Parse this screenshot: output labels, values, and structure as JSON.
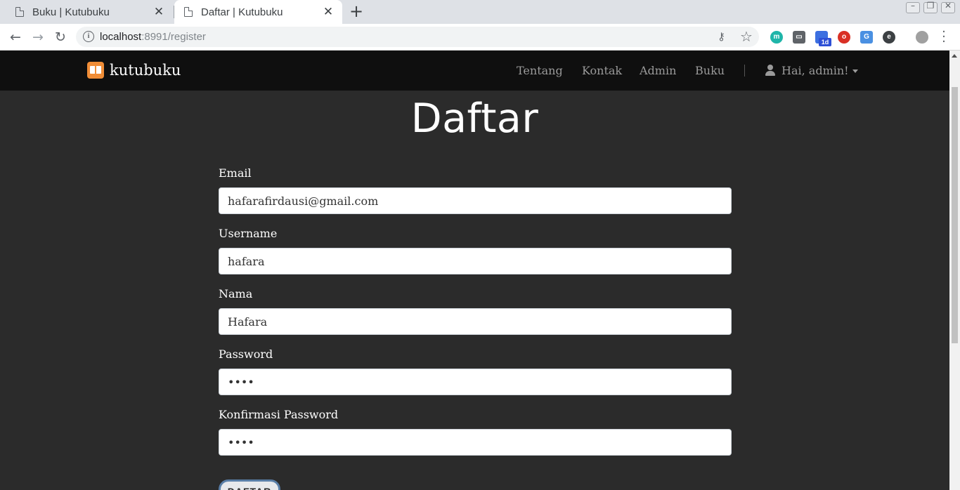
{
  "browser": {
    "tabs": [
      {
        "title": "Buku | Kutubuku",
        "active": false
      },
      {
        "title": "Daftar | Kutubuku",
        "active": true
      }
    ],
    "url_host": "localhost",
    "url_path": ":8991/register",
    "extensions": [
      {
        "name": "m",
        "color": "#1fb5a9"
      },
      {
        "name": "1d",
        "color": "#2d4fd6"
      }
    ],
    "icons": {
      "back": "arrow-left-icon",
      "forward": "arrow-right-icon",
      "reload": "reload-icon",
      "new_tab": "plus-icon",
      "close": "close-icon"
    }
  },
  "navbar": {
    "brand": "kutubuku",
    "links": [
      "Tentang",
      "Kontak",
      "Admin",
      "Buku"
    ],
    "user_greeting": "Hai, admin!"
  },
  "form": {
    "title": "Daftar",
    "fields": [
      {
        "label": "Email",
        "value": "hafarafirdausi@gmail.com"
      },
      {
        "label": "Username",
        "value": "hafara"
      },
      {
        "label": "Nama",
        "value": "Hafara"
      },
      {
        "label": "Password",
        "value": "••••"
      },
      {
        "label": "Konfirmasi Password",
        "value": "••••"
      }
    ],
    "submit_label": "DAFTAR"
  },
  "colors": {
    "page_bg": "#2b2b2b",
    "navbar_bg": "#0f0f0f",
    "brand_accent": "#f08d37",
    "nav_link": "#9a9a9a"
  }
}
